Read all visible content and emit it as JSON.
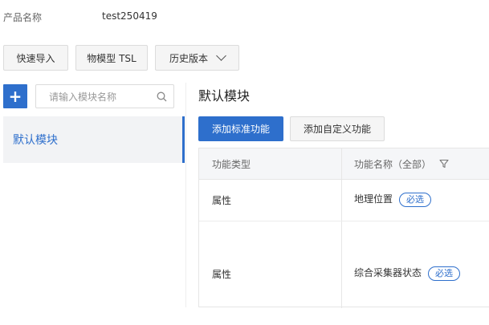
{
  "product": {
    "label": "产品名称",
    "name": "test250419"
  },
  "toolbar": {
    "quick_import": "快速导入",
    "tsl": "物模型 TSL",
    "history": "历史版本"
  },
  "sidebar": {
    "add_label": "+",
    "search_placeholder": "请输入模块名称",
    "items": [
      {
        "label": "默认模块"
      }
    ]
  },
  "main": {
    "title": "默认模块",
    "add_standard": "添加标准功能",
    "add_custom": "添加自定义功能",
    "table": {
      "headers": {
        "type": "功能类型",
        "name": "功能名称（全部）"
      },
      "rows": [
        {
          "type": "属性",
          "name": "地理位置",
          "badge": "必选"
        },
        {
          "type": "属性",
          "name": "综合采集器状态",
          "badge": "必选"
        }
      ]
    }
  },
  "colors": {
    "accent": "#2e6fcc"
  },
  "icons": {
    "search": "search-icon",
    "filter": "filter-icon",
    "chevron": "chevron-down-icon"
  }
}
